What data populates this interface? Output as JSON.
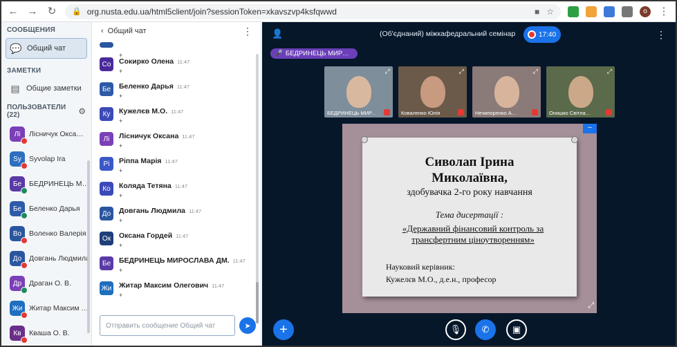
{
  "browser": {
    "url": "org.nusta.edu.ua/html5client/join?sessionToken=xkavszvp4ksfqwwd",
    "profile_initial": "o"
  },
  "sidebar": {
    "messages_title": "СООБЩЕНИЯ",
    "public_chat": "Общий чат",
    "notes_title": "ЗАМЕТКИ",
    "shared_notes": "Общие заметки",
    "users_title": "ПОЛЬЗОВАТЕЛИ (22)",
    "users": [
      {
        "initials": "Лі",
        "name": "Лісничук Окса…",
        "suffix": "(Вы)",
        "color": "#7b3fb8",
        "badge": "#e53935"
      },
      {
        "initials": "Sy",
        "name": "Syvolap Ira",
        "suffix": "",
        "color": "#2e6fbf",
        "badge": "#e53935"
      },
      {
        "initials": "Бе",
        "name": "БЕДРИНЕЦЬ МИ…",
        "suffix": "",
        "color": "#5a3aa6",
        "badge": "#1f8a5a"
      },
      {
        "initials": "Бе",
        "name": "Беленко Дарья",
        "suffix": "",
        "color": "#2e5ba8",
        "badge": "#1f8a5a"
      },
      {
        "initials": "Во",
        "name": "Воленко Валерія",
        "suffix": "",
        "color": "#2a56a0",
        "badge": "#e53935"
      },
      {
        "initials": "До",
        "name": "Довгань Людмила",
        "suffix": "",
        "color": "#2a56a0",
        "badge": "#e53935"
      },
      {
        "initials": "Др",
        "name": "Драган О. В.",
        "suffix": "",
        "color": "#7b3fb8",
        "badge": "#1f8a5a"
      },
      {
        "initials": "Жи",
        "name": "Житар Максим О…",
        "suffix": "",
        "color": "#1f6fbf",
        "badge": "#e53935"
      },
      {
        "initials": "Кв",
        "name": "Кваша О. В.",
        "suffix": "",
        "color": "#6a2f8a",
        "badge": "#e53935"
      }
    ]
  },
  "chat": {
    "back_label": "Общий чат",
    "input_placeholder": "Отправить сообщение Общий чат",
    "messages": [
      {
        "initials": "",
        "name": "",
        "time": "",
        "text": "+",
        "color": "#2a56a0"
      },
      {
        "initials": "Со",
        "name": "Сокирко Олена",
        "time": "11:47",
        "text": "+",
        "color": "#4a2a9a"
      },
      {
        "initials": "Бе",
        "name": "Беленко Дарья",
        "time": "11:47",
        "text": "+",
        "color": "#2e5ba8"
      },
      {
        "initials": "Ку",
        "name": "Кужелєв М.О.",
        "time": "11:47",
        "text": "+",
        "color": "#3b4ab8"
      },
      {
        "initials": "Лі",
        "name": "Лісничук Оксана",
        "time": "11:47",
        "text": "+",
        "color": "#7b3fb8"
      },
      {
        "initials": "Рі",
        "name": "Ріппа Марія",
        "time": "11:47",
        "text": "+",
        "color": "#3a58c8"
      },
      {
        "initials": "Ко",
        "name": "Коляда Тетяна",
        "time": "11:47",
        "text": "+",
        "color": "#3b4ab8"
      },
      {
        "initials": "До",
        "name": "Довгань Людмила",
        "time": "11:47",
        "text": "+",
        "color": "#2a56a0"
      },
      {
        "initials": "Ок",
        "name": "Оксана Гордей",
        "time": "11:47",
        "text": "+",
        "color": "#1f3f7a"
      },
      {
        "initials": "Бе",
        "name": "БЕДРИНЕЦЬ МИРОСЛАВА ДМ.",
        "time": "11:47",
        "text": "+",
        "color": "#5a3aa6"
      },
      {
        "initials": "Жи",
        "name": "Житар Максим Олегович",
        "time": "11:47",
        "text": "+",
        "color": "#1f6fbf"
      }
    ]
  },
  "meeting": {
    "title": "(Об'єднаний) міжкафедральний семінар",
    "rec_time": "17:40",
    "talking": "БЕДРИНЕЦЬ МИР…",
    "cameras": [
      {
        "label": "БЕДРИНЕЦЬ МИР…",
        "bg": "#7e8e9a",
        "face": "#d9b8a0"
      },
      {
        "label": "Коваленко Юлія",
        "bg": "#6b5a4a",
        "face": "#c89a80"
      },
      {
        "label": "Нечипоренко А…",
        "bg": "#8a7a78",
        "face": "#d8b49c"
      },
      {
        "label": "Онишко Світла…",
        "bg": "#5a6a4a",
        "face": "#caa888"
      }
    ],
    "slide": {
      "name_line1": "Сиволап Ірина",
      "name_line2": "Миколаївна,",
      "subtitle": "здобувачка 2-го року навчання",
      "theme_label": "Тема дисертації :",
      "topic_line1": "«Державний фінансовий контроль за",
      "topic_line2": "трансфертним ціноутворенням»",
      "sup_line1": "Науковий керівник:",
      "sup_line2": "Кужелєв М.О., д.е.н., професор"
    }
  }
}
